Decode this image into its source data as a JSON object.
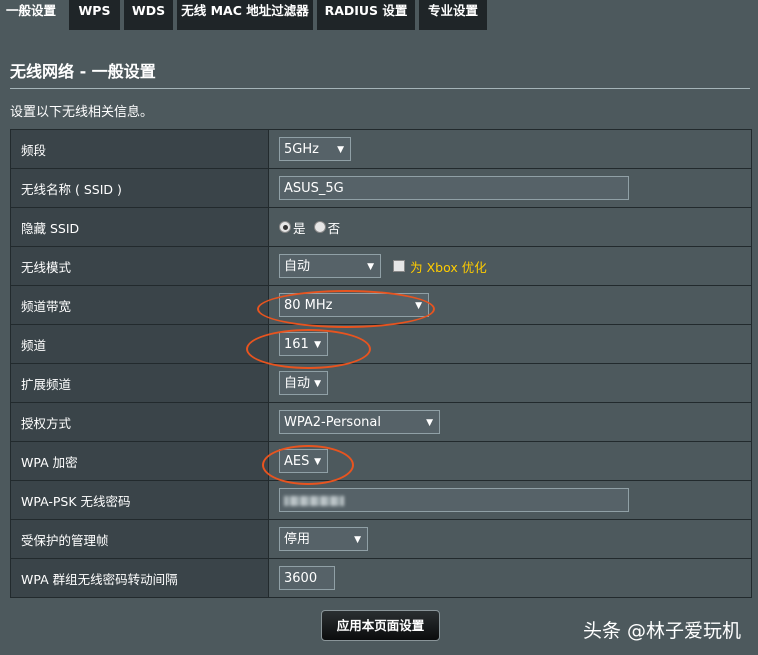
{
  "tabs": [
    {
      "label": "一般设置",
      "active": true
    },
    {
      "label": "WPS",
      "active": false
    },
    {
      "label": "WDS",
      "active": false
    },
    {
      "label": "无线 MAC 地址过滤器",
      "active": false
    },
    {
      "label": "RADIUS 设置",
      "active": false
    },
    {
      "label": "专业设置",
      "active": false
    }
  ],
  "page": {
    "title": "无线网络 - 一般设置",
    "description": "设置以下无线相关信息。"
  },
  "rows": {
    "band": {
      "label": "频段",
      "value": "5GHz"
    },
    "ssid": {
      "label": "无线名称 ( SSID )",
      "value": "ASUS_5G"
    },
    "hide_ssid": {
      "label": "隐藏 SSID",
      "option_yes": "是",
      "option_no": "否",
      "selected": "是"
    },
    "wireless_mode": {
      "label": "无线模式",
      "value": "自动",
      "xbox_label": "为 Xbox 优化",
      "xbox_checked": false
    },
    "bandwidth": {
      "label": "频道带宽",
      "value": "80 MHz"
    },
    "channel": {
      "label": "频道",
      "value": "161"
    },
    "ext_channel": {
      "label": "扩展频道",
      "value": "自动"
    },
    "auth_method": {
      "label": "授权方式",
      "value": "WPA2-Personal"
    },
    "wpa_encryption": {
      "label": "WPA 加密",
      "value": "AES"
    },
    "wpa_psk": {
      "label": "WPA-PSK 无线密码",
      "value": ""
    },
    "pmf": {
      "label": "受保护的管理帧",
      "value": "停用"
    },
    "group_key_interval": {
      "label": "WPA 群组无线密码转动间隔",
      "value": "3600"
    }
  },
  "apply_button": "应用本页面设置",
  "watermark": "头条 @林子爱玩机",
  "colors": {
    "page_bg": "#4d595d",
    "label_bg": "#3a4449",
    "tab_bg": "#1f2528",
    "highlight": "#e8541f",
    "xbox_text": "#ffcc00"
  }
}
